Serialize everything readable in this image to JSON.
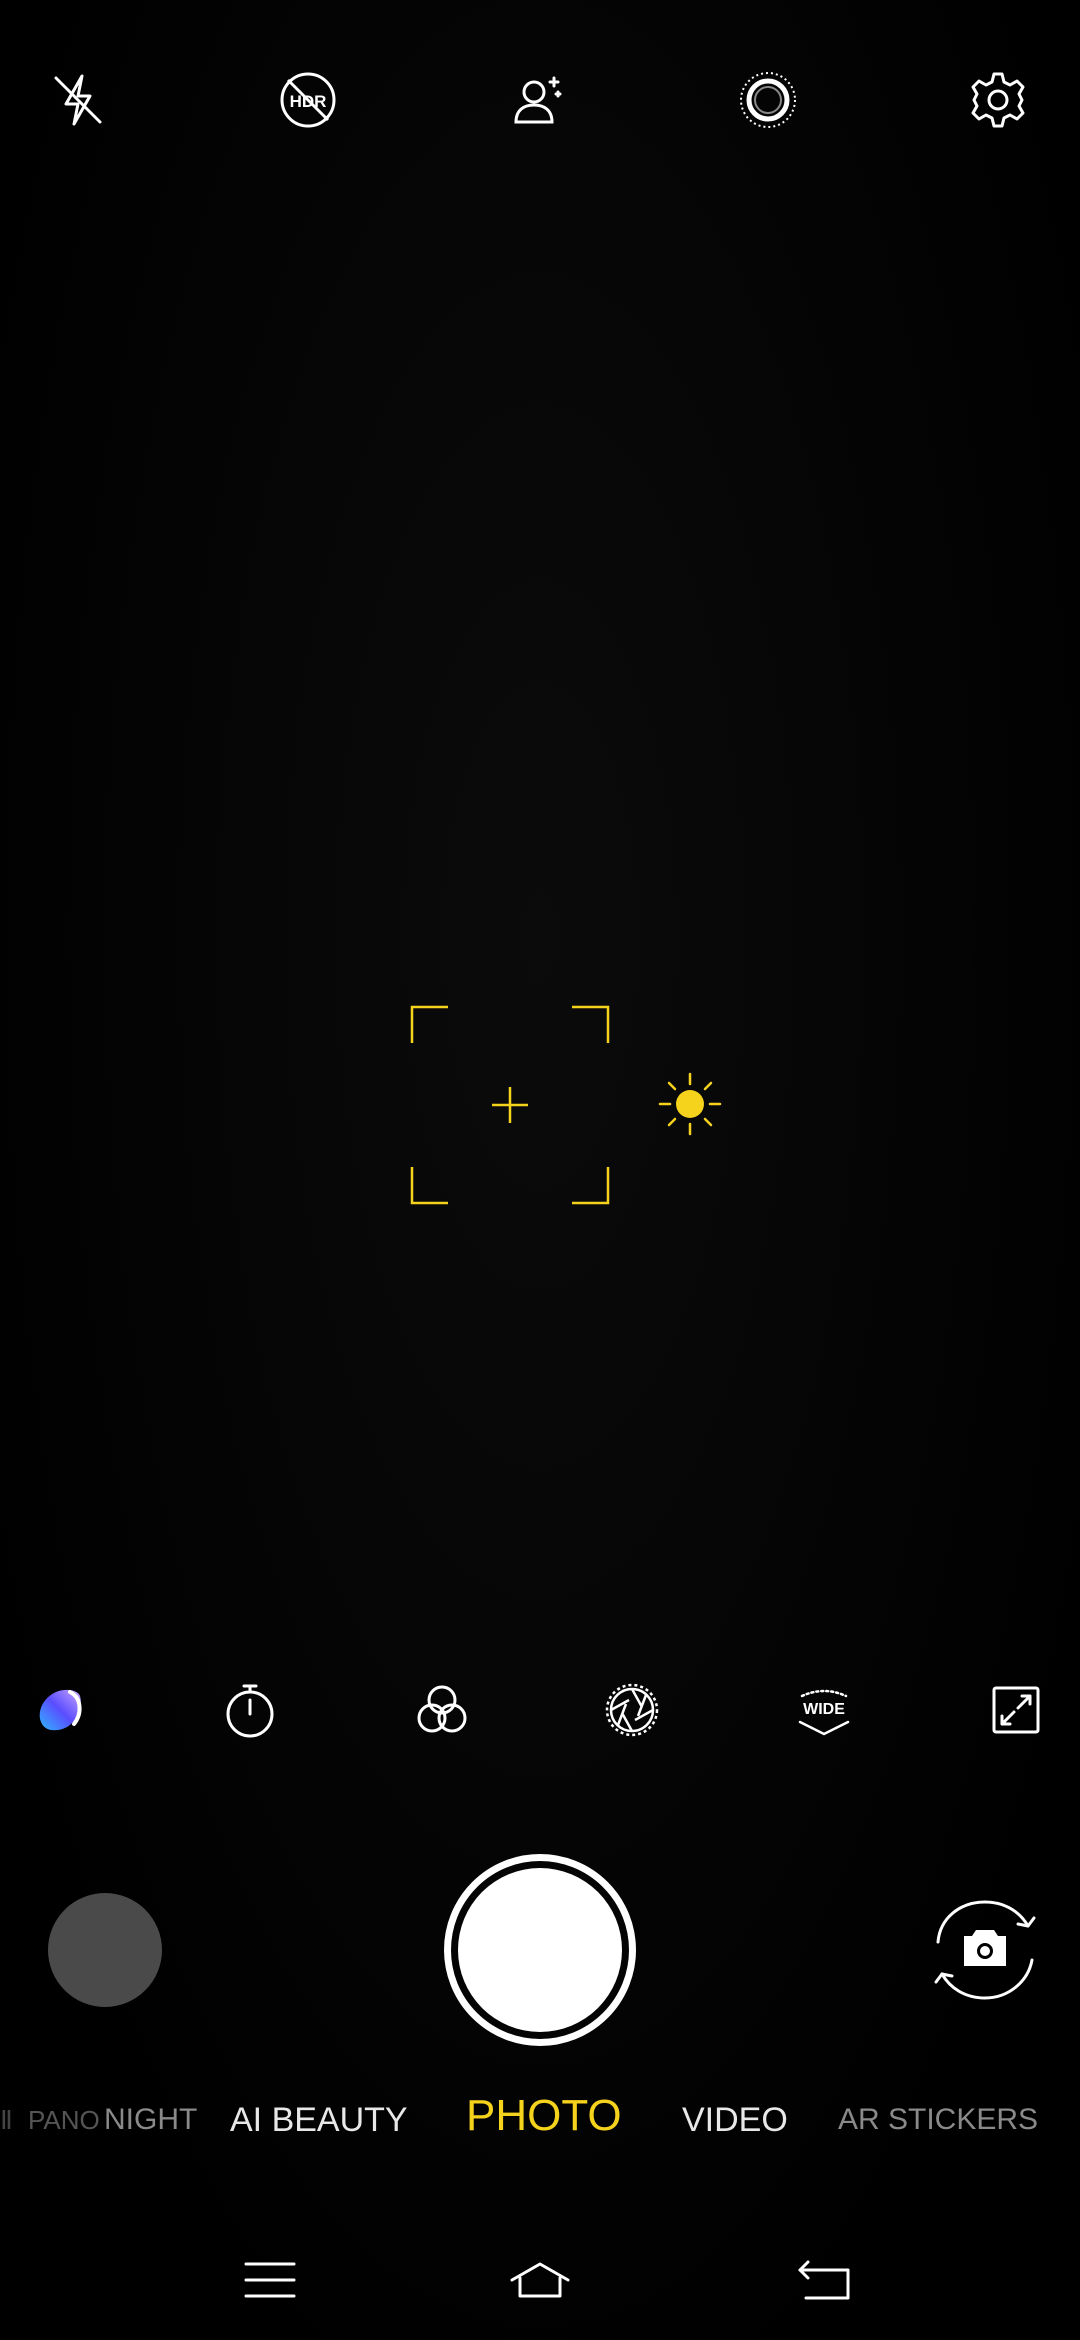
{
  "app": "Camera",
  "top_bar": {
    "flash": "flash-off-icon",
    "hdr": "hdr-off-icon",
    "hdr_label": "HDR",
    "portrait": "ai-portrait-icon",
    "lens": "lens-ring-icon",
    "settings": "settings-gear-icon"
  },
  "viewfinder": {
    "focus": "focus-frame",
    "exposure": "exposure-sun-icon",
    "accent_color": "#f5d21c"
  },
  "tools": {
    "items": [
      {
        "name": "beauty-color-icon"
      },
      {
        "name": "timer-icon"
      },
      {
        "name": "filters-icon"
      },
      {
        "name": "aperture-icon"
      },
      {
        "name": "wide-angle-icon",
        "label": "WIDE"
      },
      {
        "name": "aspect-ratio-icon"
      }
    ]
  },
  "capture": {
    "gallery": "gallery-thumbnail",
    "shutter": "shutter-button",
    "switch": "switch-camera-icon"
  },
  "modes": {
    "items": [
      {
        "label": "PANO",
        "state": "faded"
      },
      {
        "label": "NIGHT",
        "state": "dim"
      },
      {
        "label": "AI BEAUTY",
        "state": "normal"
      },
      {
        "label": "PHOTO",
        "state": "active"
      },
      {
        "label": "VIDEO",
        "state": "normal"
      },
      {
        "label": "AR STICKERS",
        "state": "dim"
      }
    ]
  },
  "nav": {
    "menu": "menu-icon",
    "home": "home-icon",
    "back": "back-icon"
  }
}
